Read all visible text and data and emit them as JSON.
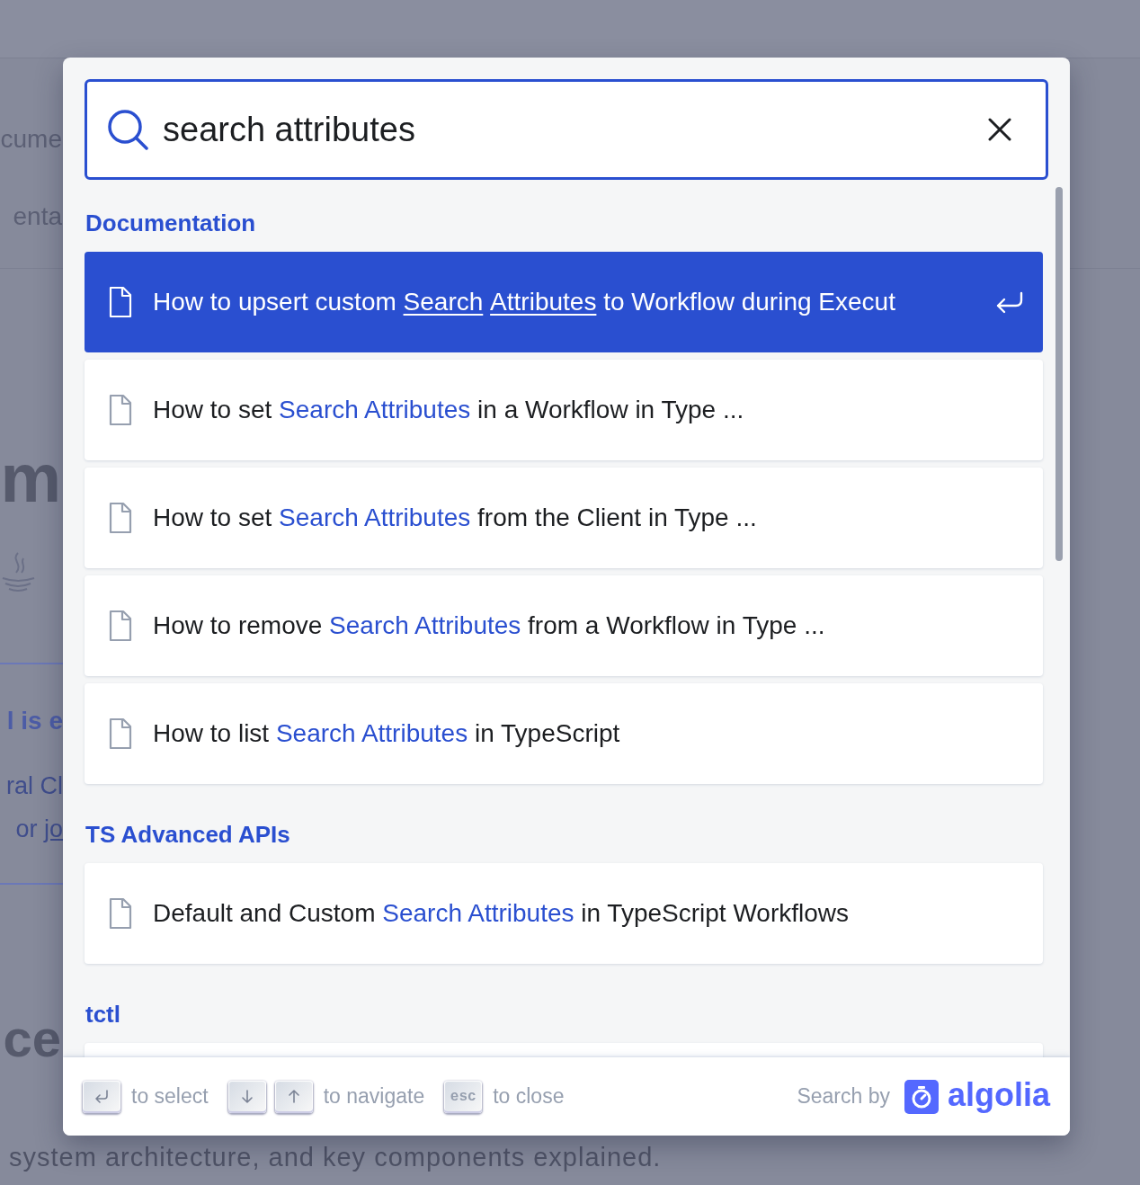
{
  "background": {
    "fragments": [
      {
        "kind": "nav",
        "text": "cume"
      },
      {
        "kind": "nav",
        "text": "enta"
      },
      {
        "kind": "hero",
        "text": "m"
      },
      {
        "kind": "java"
      },
      {
        "kind": "rule"
      },
      {
        "kind": "bold_link",
        "text": "l is e"
      },
      {
        "kind": "light",
        "text": "ral Cl"
      },
      {
        "kind": "light_link",
        "text": "or ",
        "link": "jo"
      },
      {
        "kind": "rule"
      },
      {
        "kind": "hero_small",
        "text": "ce"
      }
    ],
    "caption": "system architecture, and key components explained."
  },
  "search": {
    "value": "search attributes"
  },
  "sections": [
    {
      "title": "Documentation",
      "results": [
        {
          "selected": true,
          "parts": [
            {
              "text": "How to upsert custom ",
              "hit": false
            },
            {
              "text": "Search",
              "hit": true
            },
            {
              "text": "Attributes",
              "hit": true
            },
            {
              "text": " to Workflow during Execut",
              "hit": false
            }
          ]
        },
        {
          "selected": false,
          "parts": [
            {
              "text": "How to set ",
              "hit": false
            },
            {
              "text": "Search Attributes",
              "hit": true
            },
            {
              "text": " in a Workflow in Type ...",
              "hit": false
            }
          ]
        },
        {
          "selected": false,
          "parts": [
            {
              "text": "How to set ",
              "hit": false
            },
            {
              "text": "Search Attributes",
              "hit": true
            },
            {
              "text": " from the Client in Type ...",
              "hit": false
            }
          ]
        },
        {
          "selected": false,
          "parts": [
            {
              "text": "How to remove ",
              "hit": false
            },
            {
              "text": "Search Attributes",
              "hit": true
            },
            {
              "text": " from a Workflow in Type ...",
              "hit": false
            }
          ]
        },
        {
          "selected": false,
          "parts": [
            {
              "text": "How to list ",
              "hit": false
            },
            {
              "text": "Search Attributes",
              "hit": true
            },
            {
              "text": " in TypeScript",
              "hit": false
            }
          ]
        }
      ]
    },
    {
      "title": "TS Advanced APIs",
      "results": [
        {
          "selected": false,
          "parts": [
            {
              "text": "Default and Custom ",
              "hit": false
            },
            {
              "text": "Search Attributes",
              "hit": true
            },
            {
              "text": " in TypeScript Workflows",
              "hit": false
            }
          ]
        }
      ]
    },
    {
      "title": "tctl",
      "results": [
        {
          "selected": false
        }
      ]
    }
  ],
  "footer": {
    "hints": [
      {
        "keys": [
          {
            "kind": "enter"
          }
        ],
        "label": "to select"
      },
      {
        "keys": [
          {
            "kind": "down"
          },
          {
            "kind": "up"
          }
        ],
        "label": "to navigate"
      },
      {
        "keys": [
          {
            "kind": "text",
            "text": "esc"
          }
        ],
        "label": "to close"
      }
    ],
    "search_by": "Search by",
    "logo_text": "algolia"
  }
}
